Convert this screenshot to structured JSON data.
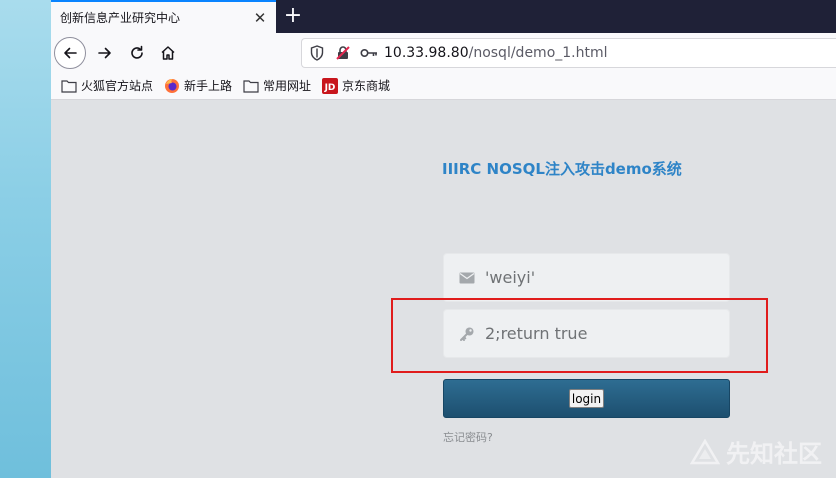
{
  "browser": {
    "tab": {
      "title": "创新信息产业研究中心",
      "close_label": "✕"
    },
    "new_tab_label": "+",
    "url": {
      "host": "10.33.98.80",
      "path": "/nosql/demo_1.html"
    },
    "bookmarks": [
      {
        "label": "火狐官方站点",
        "icon": "folder-icon"
      },
      {
        "label": "新手上路",
        "icon": "firefox-icon"
      },
      {
        "label": "常用网址",
        "icon": "folder-icon"
      },
      {
        "label": "京东商城",
        "icon": "jd-icon"
      }
    ]
  },
  "page": {
    "title": "IIIRC NOSQL注入攻击demo系统",
    "username_value": "'weiyi'",
    "password_value": "2;return true",
    "login_label": "login",
    "forgot_label": "忘记密码?",
    "watermark": "先知社区"
  },
  "colors": {
    "title": "#2e84c7",
    "login_bar": "#1d4f6f",
    "highlight": "#e01c1c",
    "tab_accent": "#0a84ff"
  }
}
